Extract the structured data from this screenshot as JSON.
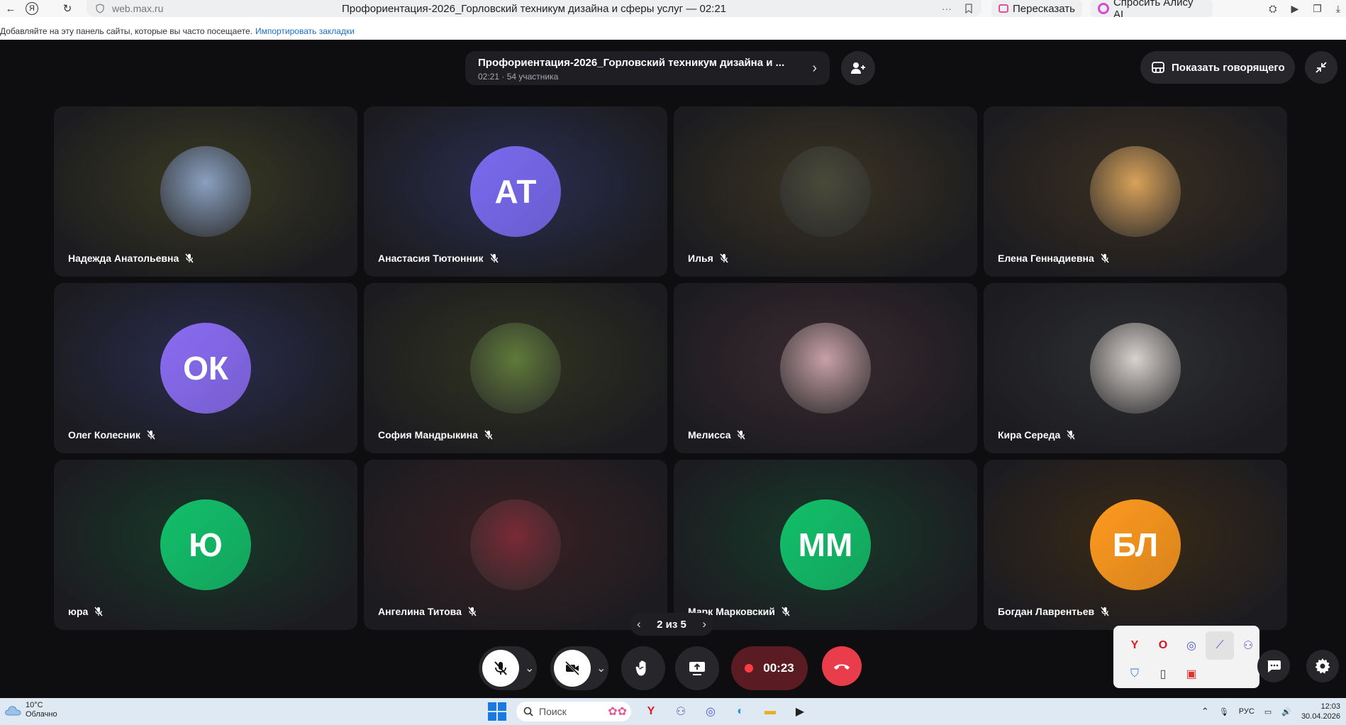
{
  "browser": {
    "back": "←",
    "yandex": "Я",
    "reload": "↻",
    "url": "web.max.ru",
    "tab_title": "Профориентация-2026_Горловский техникум дизайна и сферы услуг — 02:21",
    "more": "···",
    "retell_label": "Пересказать",
    "ask_alice_label": "Спросить Алису AI",
    "bookmarks_hint": "Добавляйте на эту панель сайты, которые вы часто посещаете.",
    "bookmarks_import": "Импортировать закладки"
  },
  "call": {
    "title": "Профориентация-2026_Горловский техникум дизайна и ...",
    "meta": "02:21 · 54 участника",
    "show_speaker_label": "Показать говорящего",
    "pager": "2 из 5",
    "timer": "00:23"
  },
  "participants": [
    {
      "name": "Надежда Анатольевна",
      "initials": "",
      "kind": "photo",
      "bg": "#3a3a22",
      "avatar": "#8aa0c0"
    },
    {
      "name": "Анастасия Тютюнник",
      "initials": "АТ",
      "kind": "initials",
      "bg": "#2a2e52",
      "avatar": "#7a6af0"
    },
    {
      "name": "Илья",
      "initials": "",
      "kind": "photo",
      "bg": "#3b3422",
      "avatar": "#4a4a3a"
    },
    {
      "name": "Елена Геннадиевна",
      "initials": "",
      "kind": "photo",
      "bg": "#3a2f20",
      "avatar": "#d9a25a"
    },
    {
      "name": "Олег Колесник",
      "initials": "ОК",
      "kind": "initials",
      "bg": "#2a2c4f",
      "avatar": "#8a6cf2"
    },
    {
      "name": "София Мандрыкина",
      "initials": "",
      "kind": "photo",
      "bg": "#31341f",
      "avatar": "#5f7a3a"
    },
    {
      "name": "Мелисса",
      "initials": "",
      "kind": "photo",
      "bg": "#3a2a30",
      "avatar": "#c7a0a8"
    },
    {
      "name": "Кира Середа",
      "initials": "",
      "kind": "photo",
      "bg": "#2e2f33",
      "avatar": "#d8d2cf"
    },
    {
      "name": "юра",
      "initials": "Ю",
      "kind": "initials",
      "bg": "#173a2a",
      "avatar": "#12c06a"
    },
    {
      "name": "Ангелина Титова",
      "initials": "",
      "kind": "photo",
      "bg": "#3a2024",
      "avatar": "#7a2a35"
    },
    {
      "name": "Марк Марковский",
      "initials": "ММ",
      "kind": "initials",
      "bg": "#173a2a",
      "avatar": "#12c06a"
    },
    {
      "name": "Богдан Лаврентьев",
      "initials": "БЛ",
      "kind": "initials",
      "bg": "#3b2a15",
      "avatar": "#ff9a1e"
    }
  ],
  "tray": [
    "Y",
    "O",
    "◎",
    "⟋",
    "⚇",
    "⛉",
    "▯",
    "▣"
  ],
  "taskbar": {
    "temp": "10°C",
    "weather": "Облачно",
    "search_placeholder": "Поиск",
    "lang": "РУС",
    "time": "12:03",
    "date": "30.04.2026"
  },
  "colors": {
    "end_call": "#ea3d4b",
    "rec_dot": "#ff3b45",
    "accent_link": "#1a6fc9"
  }
}
